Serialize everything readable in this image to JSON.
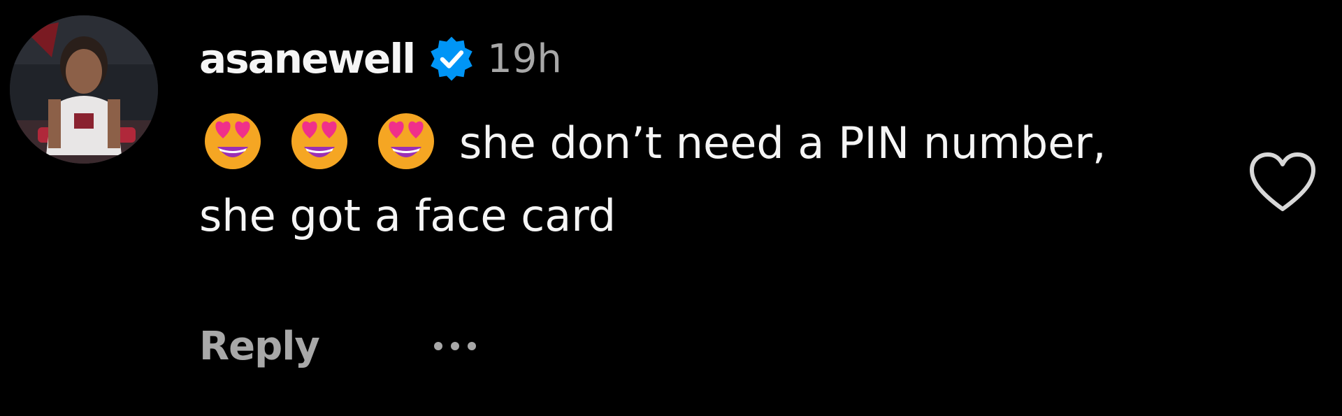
{
  "comment": {
    "username": "asanewell",
    "verified": true,
    "timestamp": "19h",
    "emojis": [
      "smiling-face-with-heart-eyes",
      "smiling-face-with-heart-eyes",
      "smiling-face-with-heart-eyes"
    ],
    "text": "she don’t need a PIN number, she got a face card",
    "reply_label": "Reply",
    "more_icon": "more-options-icon",
    "like_icon": "heart-outline-icon"
  },
  "colors": {
    "background": "#000000",
    "primary_text": "#f5f5f5",
    "secondary_text": "#a8a8a8",
    "verified_blue": "#0095f6",
    "emoji_face": "#f5a623",
    "emoji_heart": "#f0308a",
    "emoji_mouth": "#9b2fb5"
  }
}
